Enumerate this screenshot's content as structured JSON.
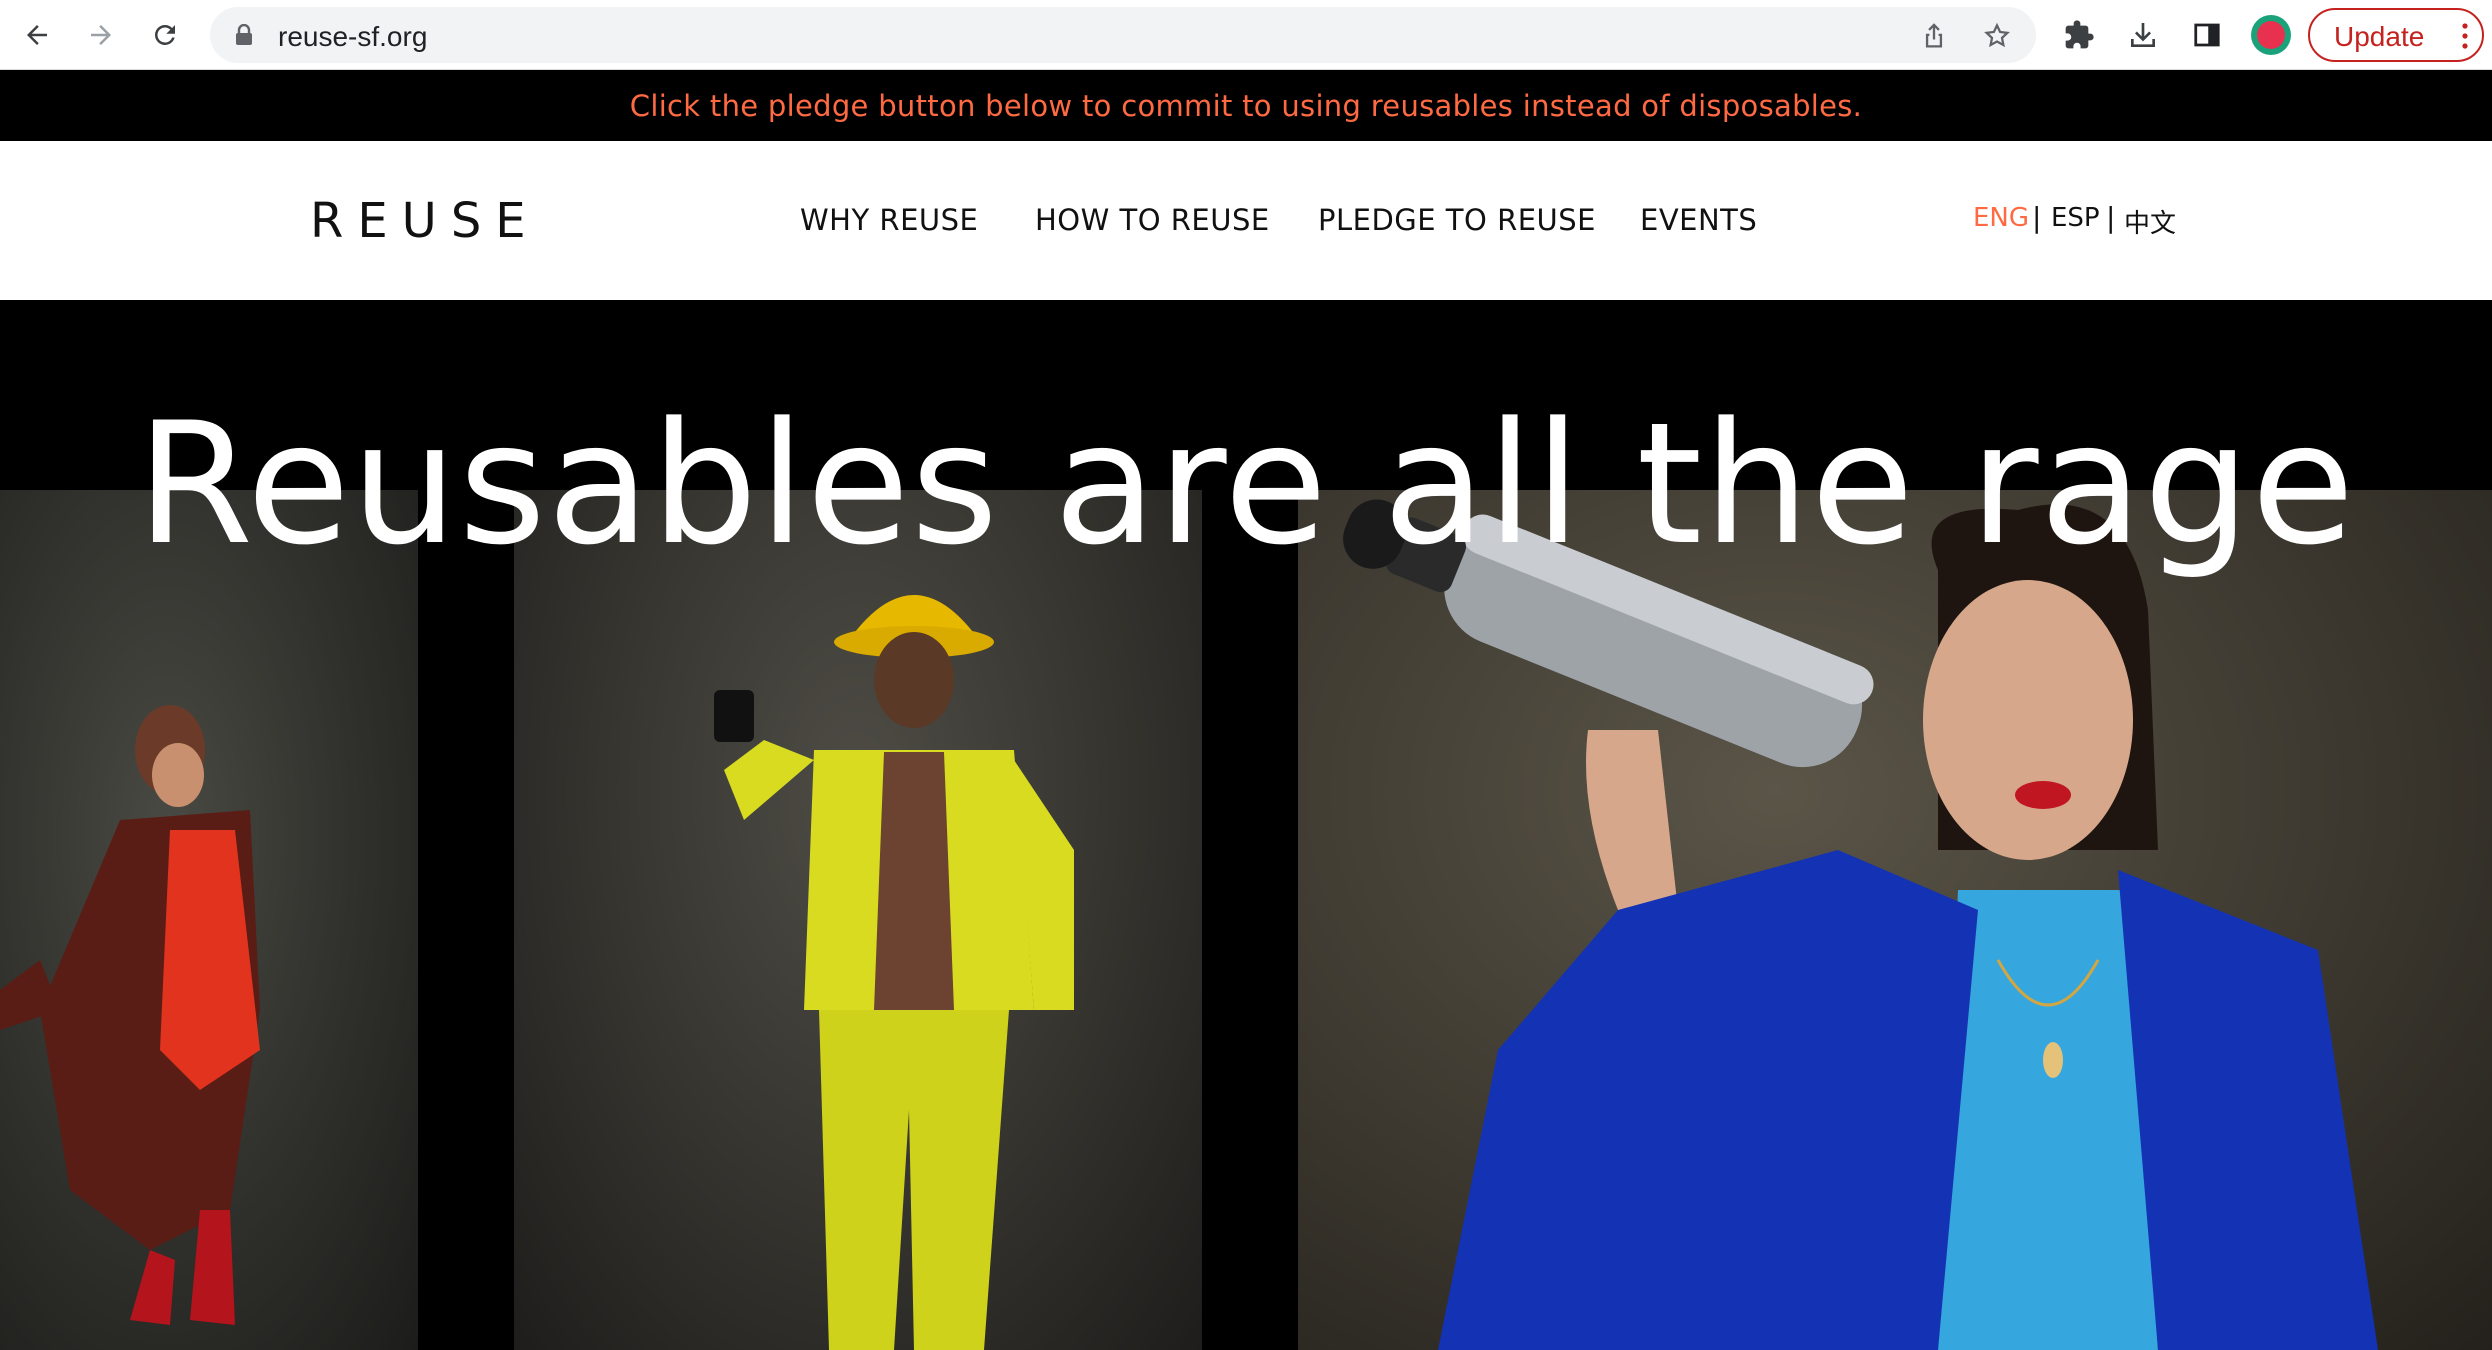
{
  "browser": {
    "url": "reuse-sf.org",
    "update_label": "Update"
  },
  "announcement": {
    "text": "Click the pledge button below to commit to using reusables instead of disposables."
  },
  "header": {
    "logo": "REUSE",
    "nav": [
      {
        "label": "WHY REUSE"
      },
      {
        "label": "HOW TO REUSE"
      },
      {
        "label": "PLEDGE TO REUSE"
      },
      {
        "label": "EVENTS"
      }
    ],
    "languages": [
      {
        "label": "ENG",
        "active": true
      },
      {
        "label": "ESP",
        "active": false
      },
      {
        "label": "中文",
        "active": false
      }
    ],
    "lang_separator": "|"
  },
  "hero": {
    "title": "Reusables are all the rage"
  },
  "colors": {
    "accent": "#ff6a43",
    "announcement_bg": "#000000",
    "update_red": "#c5221f"
  }
}
